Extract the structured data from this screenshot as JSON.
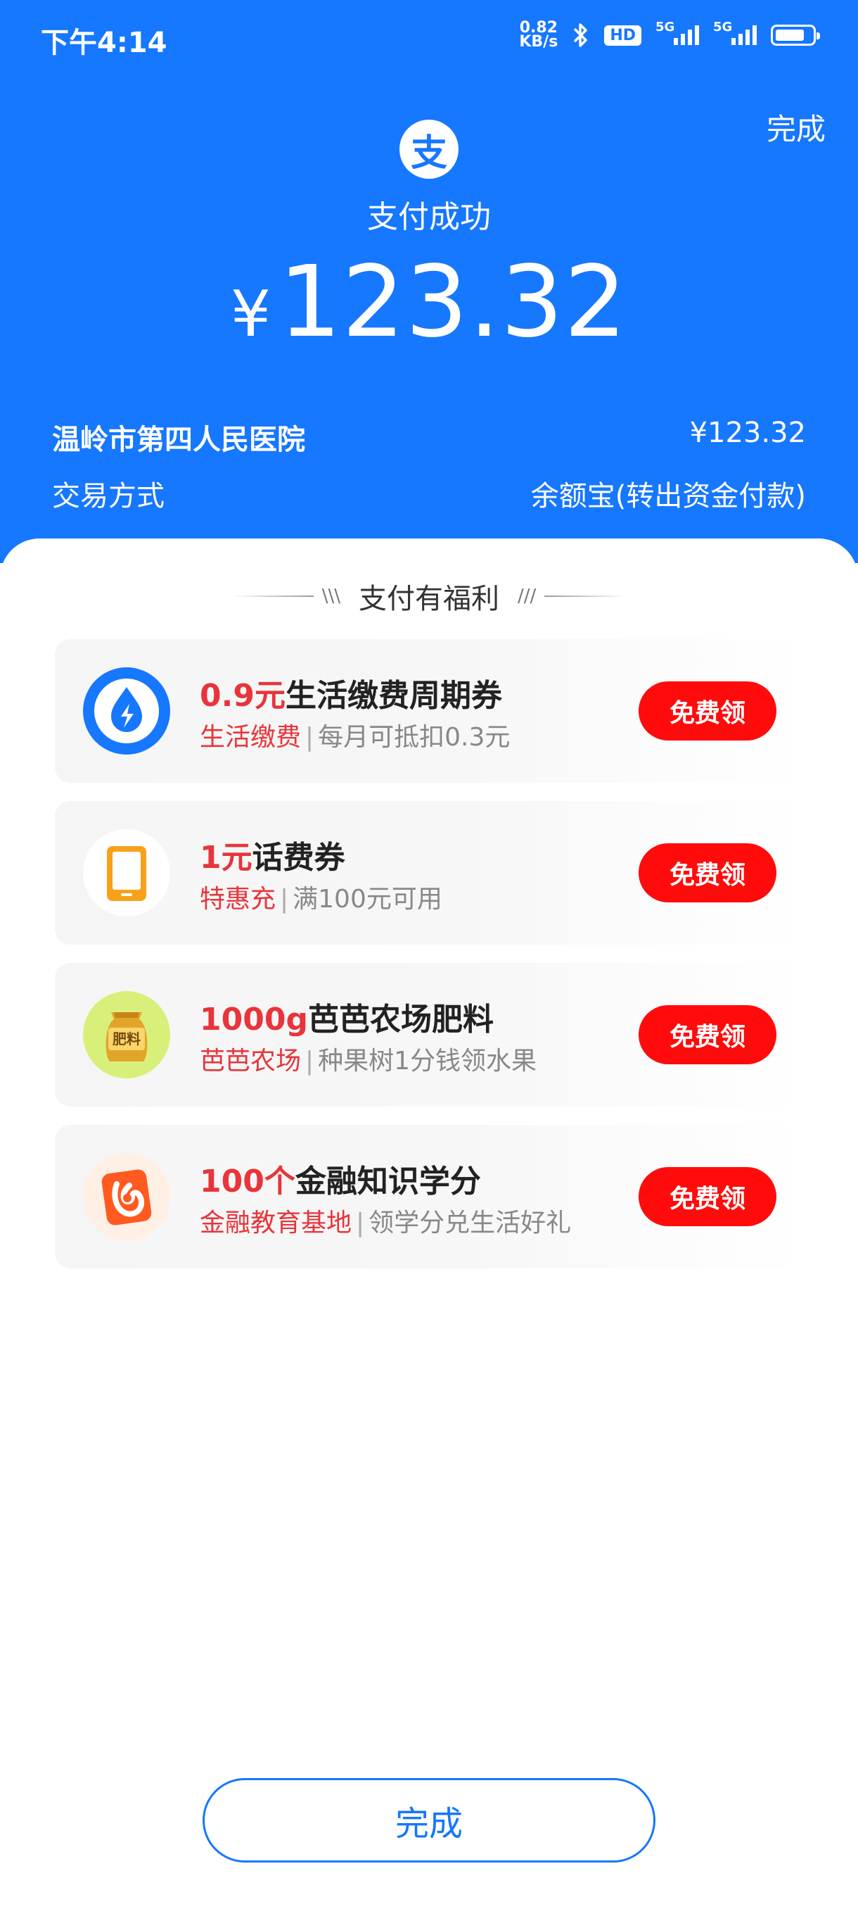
{
  "status_bar": {
    "time": "下午4:14",
    "speed_value": "0.82",
    "speed_unit": "KB/s",
    "hd": "HD",
    "sim1": "5G",
    "sim2": "5G"
  },
  "header": {
    "done": "完成",
    "logo_char": "支",
    "status": "支付成功",
    "currency": "¥",
    "amount": "123.32",
    "merchant": "温岭市第四人民医院",
    "merchant_amount": "¥123.32",
    "method_label": "交易方式",
    "method_value": "余额宝(转出资金付款)"
  },
  "benefits": {
    "title": "支付有福利",
    "deco_left": "\\\\\\",
    "deco_right": "///",
    "items": [
      {
        "highlight": "0.9元",
        "title": "生活缴费周期券",
        "tag": "生活缴费",
        "desc": "每月可抵扣0.3元",
        "button": "免费领",
        "icon": "lightning-drop-icon"
      },
      {
        "highlight": "1元",
        "title": "话费券",
        "tag": "特惠充",
        "desc": "满100元可用",
        "button": "免费领",
        "icon": "phone-icon"
      },
      {
        "highlight": "1000g",
        "title": "芭芭农场肥料",
        "tag": "芭芭农场",
        "desc": "种果树1分钱领水果",
        "button": "免费领",
        "icon_text": "肥料",
        "icon": "fertilizer-bag-icon"
      },
      {
        "highlight": "100个",
        "title": "金融知识学分",
        "tag": "金融教育基地",
        "desc": "领学分兑生活好礼",
        "button": "免费领",
        "icon": "ok-hand-icon"
      }
    ]
  },
  "footer": {
    "done": "完成"
  },
  "colors": {
    "brand_blue": "#1677FF",
    "accent_red": "#E8343A",
    "button_red": "#FF0B0B"
  }
}
